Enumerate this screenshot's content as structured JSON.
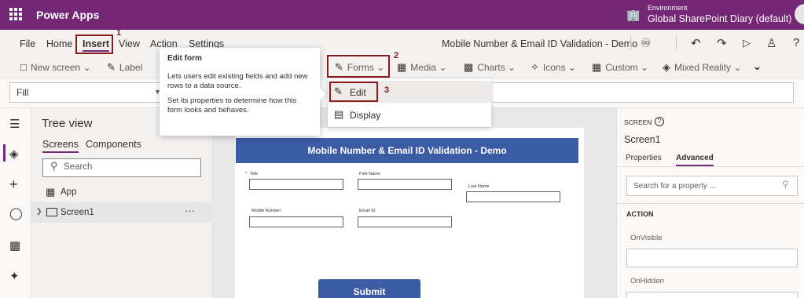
{
  "topbar": {
    "app_title": "Power Apps",
    "env_label": "Environment",
    "env_value": "Global SharePoint Diary (default)",
    "waffle_icon": "waffle-icon",
    "env_icon": "building-icon"
  },
  "menu": {
    "items": [
      "File",
      "Home",
      "Insert",
      "View",
      "Action",
      "Settings"
    ],
    "doc_title": "Mobile Number & Email ID Validation - Demo"
  },
  "annotations": [
    "1",
    "2",
    "3"
  ],
  "ribbon": {
    "new_screen": "New screen",
    "label": "Label",
    "forms": "Forms",
    "media": "Media",
    "charts": "Charts",
    "icons": "Icons",
    "custom": "Custom",
    "mixed_reality": "Mixed Reality"
  },
  "formula": {
    "property": "Fill"
  },
  "tree": {
    "title": "Tree view",
    "tabs": [
      "Screens",
      "Components"
    ],
    "search_placeholder": "Search",
    "app_label": "App",
    "screen_label": "Screen1",
    "more": "···"
  },
  "canvas": {
    "header": "Mobile Number & Email ID Validation - Demo",
    "fields": {
      "title": "Title",
      "required_mark": "*",
      "first_name": "First Name",
      "last_name": "Last Name",
      "mobile_number": "Mobile Number",
      "email_id": "Email ID"
    },
    "submit": "Submit"
  },
  "properties": {
    "kicker": "SCREEN",
    "name": "Screen1",
    "tabs": [
      "Properties",
      "Advanced"
    ],
    "search_placeholder": "Search for a property ...",
    "section": "ACTION",
    "props": [
      "OnVisible",
      "OnHidden"
    ]
  },
  "tooltip": {
    "title": "Edit form",
    "p1": "Lets users edit existing fields and add new rows to a data source.",
    "p2": "Set its properties to determine how this form looks and behaves."
  },
  "forms_menu": {
    "items": [
      "Edit",
      "Display"
    ]
  },
  "colors": {
    "brand": "#742774",
    "header_blue": "#3b5ba5",
    "annotation": "#8b1a1a"
  }
}
